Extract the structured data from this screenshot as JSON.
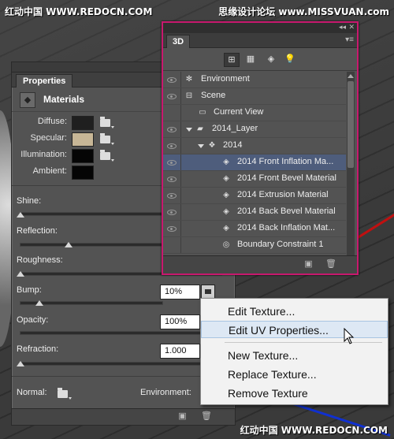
{
  "watermarks": {
    "top_left": "红动中国 WWW.REDOCN.COM",
    "top_right": "思缘设计论坛 www.MISSVUAN.com",
    "bottom_right": "红动中国 WWW.REDOCN.COM"
  },
  "properties_panel": {
    "tab_label": "Properties",
    "section_title": "Materials",
    "section_icon": "materials-icon",
    "colors": [
      {
        "label": "Diffuse:",
        "swatch": "#1f1f1f"
      },
      {
        "label": "Specular:",
        "swatch": "#c7b696"
      },
      {
        "label": "Illumination:",
        "swatch": "#050505"
      },
      {
        "label": "Ambient:",
        "swatch": "#050505"
      }
    ],
    "sliders": [
      {
        "label": "Shine:",
        "level": 0
      },
      {
        "label": "Reflection:",
        "level": 0.3
      },
      {
        "label": "Roughness:",
        "level": 0
      },
      {
        "label": "Bump:",
        "level": 0.1,
        "value": "10%"
      },
      {
        "label": "Opacity:",
        "level": 1.0,
        "value": "100%"
      },
      {
        "label": "Refraction:",
        "level": 0,
        "value": "1.000"
      }
    ],
    "normal_label": "Normal:",
    "environment_label": "Environment:"
  },
  "panel_3d": {
    "tab_label": "3D",
    "filter_icons": [
      "scene-filter-icon",
      "mesh-filter-icon",
      "material-filter-icon",
      "light-filter-icon"
    ],
    "tree": [
      {
        "label": "Environment",
        "icon": "environment-icon",
        "indent": 0,
        "selected": false
      },
      {
        "label": "Scene",
        "icon": "scene-icon",
        "indent": 0,
        "selected": false
      },
      {
        "label": "Current View",
        "icon": "camera-icon",
        "indent": 1,
        "selected": false
      },
      {
        "label": "2014_Layer",
        "icon": "folder-icon",
        "indent": 0,
        "selected": false,
        "expanded": true
      },
      {
        "label": "2014",
        "icon": "mesh-icon",
        "indent": 1,
        "selected": false,
        "expanded": true
      },
      {
        "label": "2014 Front Inflation Ma...",
        "icon": "material-icon",
        "indent": 2,
        "selected": true
      },
      {
        "label": "2014 Front Bevel Material",
        "icon": "material-icon",
        "indent": 2,
        "selected": false
      },
      {
        "label": "2014 Extrusion Material",
        "icon": "material-icon",
        "indent": 2,
        "selected": false
      },
      {
        "label": "2014 Back Bevel Material",
        "icon": "material-icon",
        "indent": 2,
        "selected": false
      },
      {
        "label": "2014 Back Inflation Mat...",
        "icon": "material-icon",
        "indent": 2,
        "selected": false
      },
      {
        "label": "Boundary Constraint 1",
        "icon": "constraint-icon",
        "indent": 2,
        "selected": false
      }
    ]
  },
  "context_menu": {
    "items": [
      {
        "label": "Edit Texture...",
        "hover": false
      },
      {
        "label": "Edit UV Properties...",
        "hover": true
      },
      {
        "label": "New Texture...",
        "hover": false
      },
      {
        "label": "Replace Texture...",
        "hover": false
      },
      {
        "label": "Remove Texture",
        "hover": false
      }
    ]
  }
}
